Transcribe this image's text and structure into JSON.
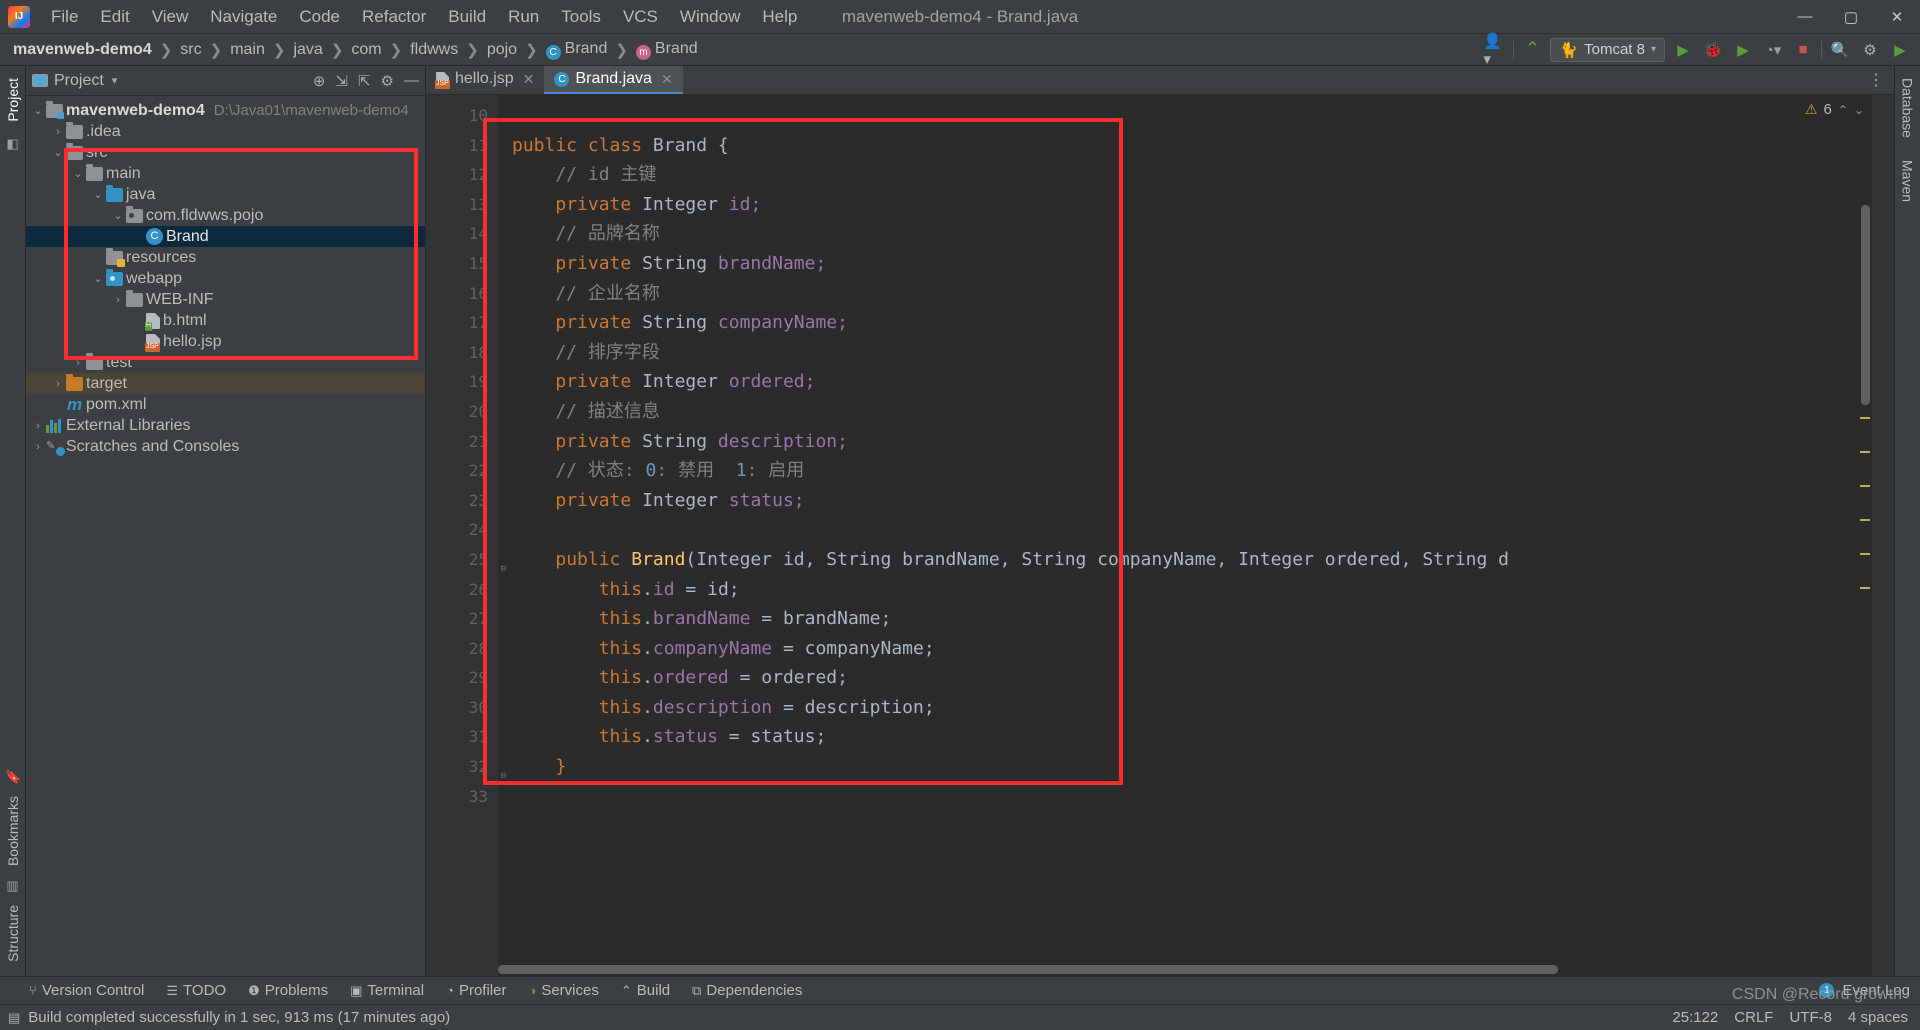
{
  "window": {
    "title": "mavenweb-demo4 - Brand.java",
    "minimize": "—",
    "maximize": "▢",
    "close": "✕"
  },
  "menu": [
    "File",
    "Edit",
    "View",
    "Navigate",
    "Code",
    "Refactor",
    "Build",
    "Run",
    "Tools",
    "VCS",
    "Window",
    "Help"
  ],
  "breadcrumbs": [
    {
      "label": "mavenweb-demo4",
      "icon": null
    },
    {
      "label": "src",
      "icon": null
    },
    {
      "label": "main",
      "icon": null
    },
    {
      "label": "java",
      "icon": null
    },
    {
      "label": "com",
      "icon": null
    },
    {
      "label": "fldwws",
      "icon": null
    },
    {
      "label": "pojo",
      "icon": null
    },
    {
      "label": "Brand",
      "icon": "class-icon"
    },
    {
      "label": "Brand",
      "icon": "method-icon"
    }
  ],
  "toolbar": {
    "run_config": "Tomcat 8",
    "account_icon": "user-icon",
    "hammer_icon": "build-icon",
    "run_icon": "run-icon",
    "debug_icon": "debug-icon",
    "coverage_icon": "run-coverage-icon",
    "profile_icon": "profiler-icon",
    "stop_icon": "stop-icon",
    "search_icon": "search-icon",
    "settings_icon": "gear-icon",
    "updates_icon": "update-icon"
  },
  "left_rail": {
    "top": [
      "Project"
    ],
    "bottom": [
      "Structure",
      "Bookmarks"
    ]
  },
  "right_rail": [
    "Database",
    "Maven"
  ],
  "project_panel": {
    "title": "Project",
    "actions": [
      "locate-icon",
      "expand-all-icon",
      "collapse-all-icon",
      "settings-icon",
      "hide-icon"
    ],
    "tree": [
      {
        "label": "mavenweb-demo4",
        "path": "D:\\Java01\\mavenweb-demo4",
        "indent": 0,
        "arrow": "expanded",
        "icon": "module-folder",
        "bold": true
      },
      {
        "label": ".idea",
        "indent": 1,
        "arrow": "collapsed",
        "icon": "folder"
      },
      {
        "label": "src",
        "indent": 1,
        "arrow": "expanded",
        "icon": "folder"
      },
      {
        "label": "main",
        "indent": 2,
        "arrow": "expanded",
        "icon": "folder"
      },
      {
        "label": "java",
        "indent": 3,
        "arrow": "expanded",
        "icon": "source-folder"
      },
      {
        "label": "com.fldwws.pojo",
        "indent": 4,
        "arrow": "expanded",
        "icon": "package"
      },
      {
        "label": "Brand",
        "indent": 5,
        "arrow": "none",
        "icon": "java-class",
        "selected": true
      },
      {
        "label": "resources",
        "indent": 3,
        "arrow": "none",
        "icon": "resources-folder"
      },
      {
        "label": "webapp",
        "indent": 3,
        "arrow": "expanded",
        "icon": "webapp-folder"
      },
      {
        "label": "WEB-INF",
        "indent": 4,
        "arrow": "collapsed",
        "icon": "folder"
      },
      {
        "label": "b.html",
        "indent": 4,
        "arrow": "none",
        "icon": "html-file"
      },
      {
        "label": "hello.jsp",
        "indent": 4,
        "arrow": "none",
        "icon": "jsp-file"
      },
      {
        "label": "test",
        "indent": 2,
        "arrow": "collapsed",
        "icon": "folder"
      },
      {
        "label": "target",
        "indent": 1,
        "arrow": "collapsed",
        "icon": "target-folder",
        "highlight": true
      },
      {
        "label": "pom.xml",
        "indent": 1,
        "arrow": "none",
        "icon": "maven-file"
      },
      {
        "label": "External Libraries",
        "indent": 0,
        "arrow": "collapsed",
        "icon": "libraries"
      },
      {
        "label": "Scratches and Consoles",
        "indent": 0,
        "arrow": "collapsed",
        "icon": "scratches"
      }
    ]
  },
  "editor": {
    "tabs": [
      {
        "label": "hello.jsp",
        "icon": "jsp-file",
        "active": false,
        "close": "✕"
      },
      {
        "label": "Brand.java",
        "icon": "java-class",
        "active": true,
        "close": "✕"
      }
    ],
    "warnings_count": "6",
    "warning_icon": "warning-triangle-icon",
    "first_line_number": 10,
    "lines": [
      {
        "n": 10,
        "tokens": []
      },
      {
        "n": 11,
        "tokens": [
          {
            "t": "public ",
            "c": "kw"
          },
          {
            "t": "class ",
            "c": "kw"
          },
          {
            "t": "Brand {",
            "c": "type"
          }
        ]
      },
      {
        "n": 12,
        "tokens": [
          {
            "t": "    // id 主键",
            "c": "cmt"
          }
        ]
      },
      {
        "n": 13,
        "tokens": [
          {
            "t": "    ",
            "c": "type"
          },
          {
            "t": "private ",
            "c": "kw"
          },
          {
            "t": "Integer ",
            "c": "type"
          },
          {
            "t": "id;",
            "c": "fld"
          }
        ]
      },
      {
        "n": 14,
        "tokens": [
          {
            "t": "    // 品牌名称",
            "c": "cmt"
          }
        ]
      },
      {
        "n": 15,
        "tokens": [
          {
            "t": "    ",
            "c": "type"
          },
          {
            "t": "private ",
            "c": "kw"
          },
          {
            "t": "String ",
            "c": "type"
          },
          {
            "t": "brandName;",
            "c": "fld"
          }
        ]
      },
      {
        "n": 16,
        "tokens": [
          {
            "t": "    // 企业名称",
            "c": "cmt"
          }
        ]
      },
      {
        "n": 17,
        "tokens": [
          {
            "t": "    ",
            "c": "type"
          },
          {
            "t": "private ",
            "c": "kw"
          },
          {
            "t": "String ",
            "c": "type"
          },
          {
            "t": "companyName;",
            "c": "fld"
          }
        ]
      },
      {
        "n": 18,
        "tokens": [
          {
            "t": "    // 排序字段",
            "c": "cmt"
          }
        ]
      },
      {
        "n": 19,
        "tokens": [
          {
            "t": "    ",
            "c": "type"
          },
          {
            "t": "private ",
            "c": "kw"
          },
          {
            "t": "Integer ",
            "c": "type"
          },
          {
            "t": "ordered;",
            "c": "fld"
          }
        ]
      },
      {
        "n": 20,
        "tokens": [
          {
            "t": "    // 描述信息",
            "c": "cmt"
          }
        ]
      },
      {
        "n": 21,
        "tokens": [
          {
            "t": "    ",
            "c": "type"
          },
          {
            "t": "private ",
            "c": "kw"
          },
          {
            "t": "String ",
            "c": "type"
          },
          {
            "t": "description;",
            "c": "fld"
          }
        ]
      },
      {
        "n": 22,
        "tokens": [
          {
            "t": "    // 状态: ",
            "c": "cmt"
          },
          {
            "t": "0",
            "c": "num"
          },
          {
            "t": ": 禁用  ",
            "c": "cmt"
          },
          {
            "t": "1",
            "c": "num"
          },
          {
            "t": ": 启用",
            "c": "cmt"
          }
        ]
      },
      {
        "n": 23,
        "tokens": [
          {
            "t": "    ",
            "c": "type"
          },
          {
            "t": "private ",
            "c": "kw"
          },
          {
            "t": "Integer ",
            "c": "type"
          },
          {
            "t": "status;",
            "c": "fld"
          }
        ]
      },
      {
        "n": 24,
        "tokens": []
      },
      {
        "n": 25,
        "tokens": [
          {
            "t": "    ",
            "c": "type"
          },
          {
            "t": "public ",
            "c": "kw"
          },
          {
            "t": "Brand",
            "c": "mth"
          },
          {
            "t": "(Integer id, String brandName, String companyName, Integer ordered, String d",
            "c": "type"
          }
        ],
        "fold": true
      },
      {
        "n": 26,
        "tokens": [
          {
            "t": "        ",
            "c": "type"
          },
          {
            "t": "this",
            "c": "kw"
          },
          {
            "t": ".",
            "c": "type"
          },
          {
            "t": "id",
            "c": "fld"
          },
          {
            "t": " = id;",
            "c": "type"
          }
        ]
      },
      {
        "n": 27,
        "tokens": [
          {
            "t": "        ",
            "c": "type"
          },
          {
            "t": "this",
            "c": "kw"
          },
          {
            "t": ".",
            "c": "type"
          },
          {
            "t": "brandName",
            "c": "fld"
          },
          {
            "t": " = brandName;",
            "c": "type"
          }
        ]
      },
      {
        "n": 28,
        "tokens": [
          {
            "t": "        ",
            "c": "type"
          },
          {
            "t": "this",
            "c": "kw"
          },
          {
            "t": ".",
            "c": "type"
          },
          {
            "t": "companyName",
            "c": "fld"
          },
          {
            "t": " = companyName;",
            "c": "type"
          }
        ]
      },
      {
        "n": 29,
        "tokens": [
          {
            "t": "        ",
            "c": "type"
          },
          {
            "t": "this",
            "c": "kw"
          },
          {
            "t": ".",
            "c": "type"
          },
          {
            "t": "ordered",
            "c": "fld"
          },
          {
            "t": " = ordered;",
            "c": "type"
          }
        ]
      },
      {
        "n": 30,
        "tokens": [
          {
            "t": "        ",
            "c": "type"
          },
          {
            "t": "this",
            "c": "kw"
          },
          {
            "t": ".",
            "c": "type"
          },
          {
            "t": "description",
            "c": "fld"
          },
          {
            "t": " = description;",
            "c": "type"
          }
        ]
      },
      {
        "n": 31,
        "tokens": [
          {
            "t": "        ",
            "c": "type"
          },
          {
            "t": "this",
            "c": "kw"
          },
          {
            "t": ".",
            "c": "type"
          },
          {
            "t": "status",
            "c": "fld"
          },
          {
            "t": " = status;",
            "c": "type"
          }
        ]
      },
      {
        "n": 32,
        "tokens": [
          {
            "t": "    ",
            "c": "type"
          },
          {
            "t": "}",
            "c": "kw"
          }
        ],
        "fold": true
      },
      {
        "n": 33,
        "tokens": []
      }
    ]
  },
  "bottom_bar": {
    "items": [
      {
        "label": "Version Control",
        "icon": "branch-icon"
      },
      {
        "label": "TODO",
        "icon": "list-icon"
      },
      {
        "label": "Problems",
        "icon": "error-icon"
      },
      {
        "label": "Terminal",
        "icon": "terminal-icon"
      },
      {
        "label": "Profiler",
        "icon": "profiler-icon"
      },
      {
        "label": "Services",
        "icon": "services-icon"
      },
      {
        "label": "Build",
        "icon": "hammer-icon"
      },
      {
        "label": "Dependencies",
        "icon": "dependencies-icon"
      }
    ],
    "event_log": "Event Log",
    "event_count": "1"
  },
  "status_bar": {
    "message": "Build completed successfully in 1 sec, 913 ms (17 minutes ago)",
    "icon": "build-status-icon",
    "caret": "25:122",
    "line_sep": "CRLF",
    "encoding": "UTF-8",
    "indent": "4 spaces"
  },
  "watermark": "CSDN @Record growth",
  "colors": {
    "accent": "#3592c4",
    "annotation": "#ff2d2d",
    "selection": "#0d293e",
    "keyword": "#cc7832",
    "field": "#9876aa",
    "comment": "#808080"
  }
}
